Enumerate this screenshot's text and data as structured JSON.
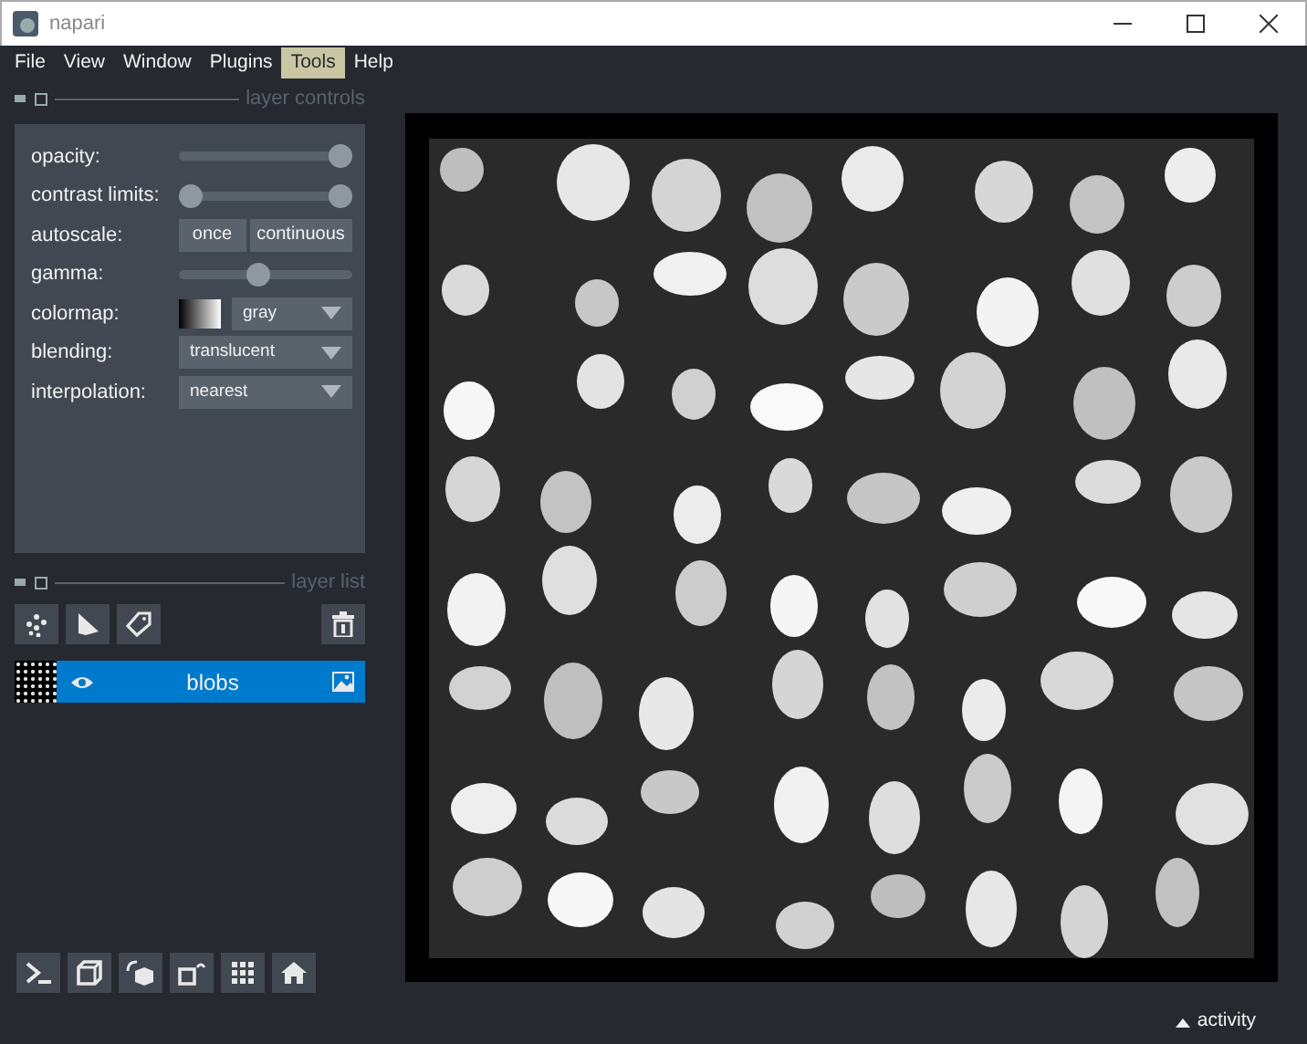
{
  "window": {
    "title": "napari"
  },
  "menu": [
    {
      "label": "File",
      "hovered": false
    },
    {
      "label": "View",
      "hovered": false
    },
    {
      "label": "Window",
      "hovered": false
    },
    {
      "label": "Plugins",
      "hovered": false
    },
    {
      "label": "Tools",
      "hovered": true
    },
    {
      "label": "Help",
      "hovered": false
    }
  ],
  "layer_controls": {
    "title": "layer controls",
    "rows": [
      {
        "kind": "slider",
        "label": "opacity:",
        "level": 1
      },
      {
        "kind": "range",
        "label": "contrast limits:",
        "level": 1
      },
      {
        "kind": "buttons",
        "label": "autoscale:",
        "buttons": [
          "once",
          "continuous"
        ]
      },
      {
        "kind": "slider",
        "label": "gamma:",
        "level": 0.45
      },
      {
        "kind": "colormap",
        "label": "colormap:",
        "value": "gray"
      },
      {
        "kind": "dropdown",
        "label": "blending:",
        "value": "translucent"
      },
      {
        "kind": "dropdown",
        "label": "interpolation:",
        "value": "nearest"
      }
    ]
  },
  "layer_list": {
    "title": "layer list",
    "layers": [
      {
        "name": "blobs",
        "visible": true,
        "selected": true
      }
    ]
  },
  "status_bar": {
    "activity": "activity"
  }
}
